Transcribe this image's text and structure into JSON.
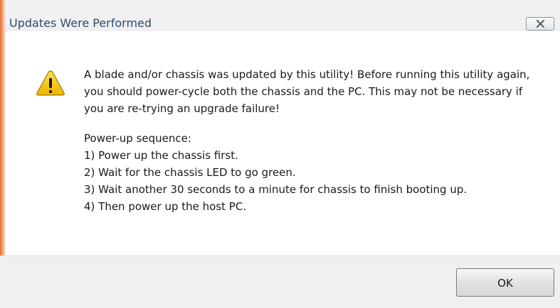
{
  "dialog": {
    "title": "Updates Were Performed",
    "icon": "warning-icon",
    "message_paragraph": "A blade and/or chassis was updated by this utility!  Before running this utility again, you should power-cycle both the chassis and the PC.  This may not be necessary if you are re-trying an upgrade failure!",
    "sequence_heading": "Power-up sequence:",
    "steps": [
      "1) Power up the chassis first.",
      "2) Wait for the chassis LED to go green.",
      "3) Wait another 30 seconds to a minute for chassis to finish booting up.",
      "4) Then power up the host PC."
    ],
    "ok_label": "OK",
    "close_icon": "close-icon"
  },
  "colors": {
    "title_text": "#2d4a72",
    "accent_edge": "#e66b2e",
    "warning_yellow": "#f5c400"
  }
}
